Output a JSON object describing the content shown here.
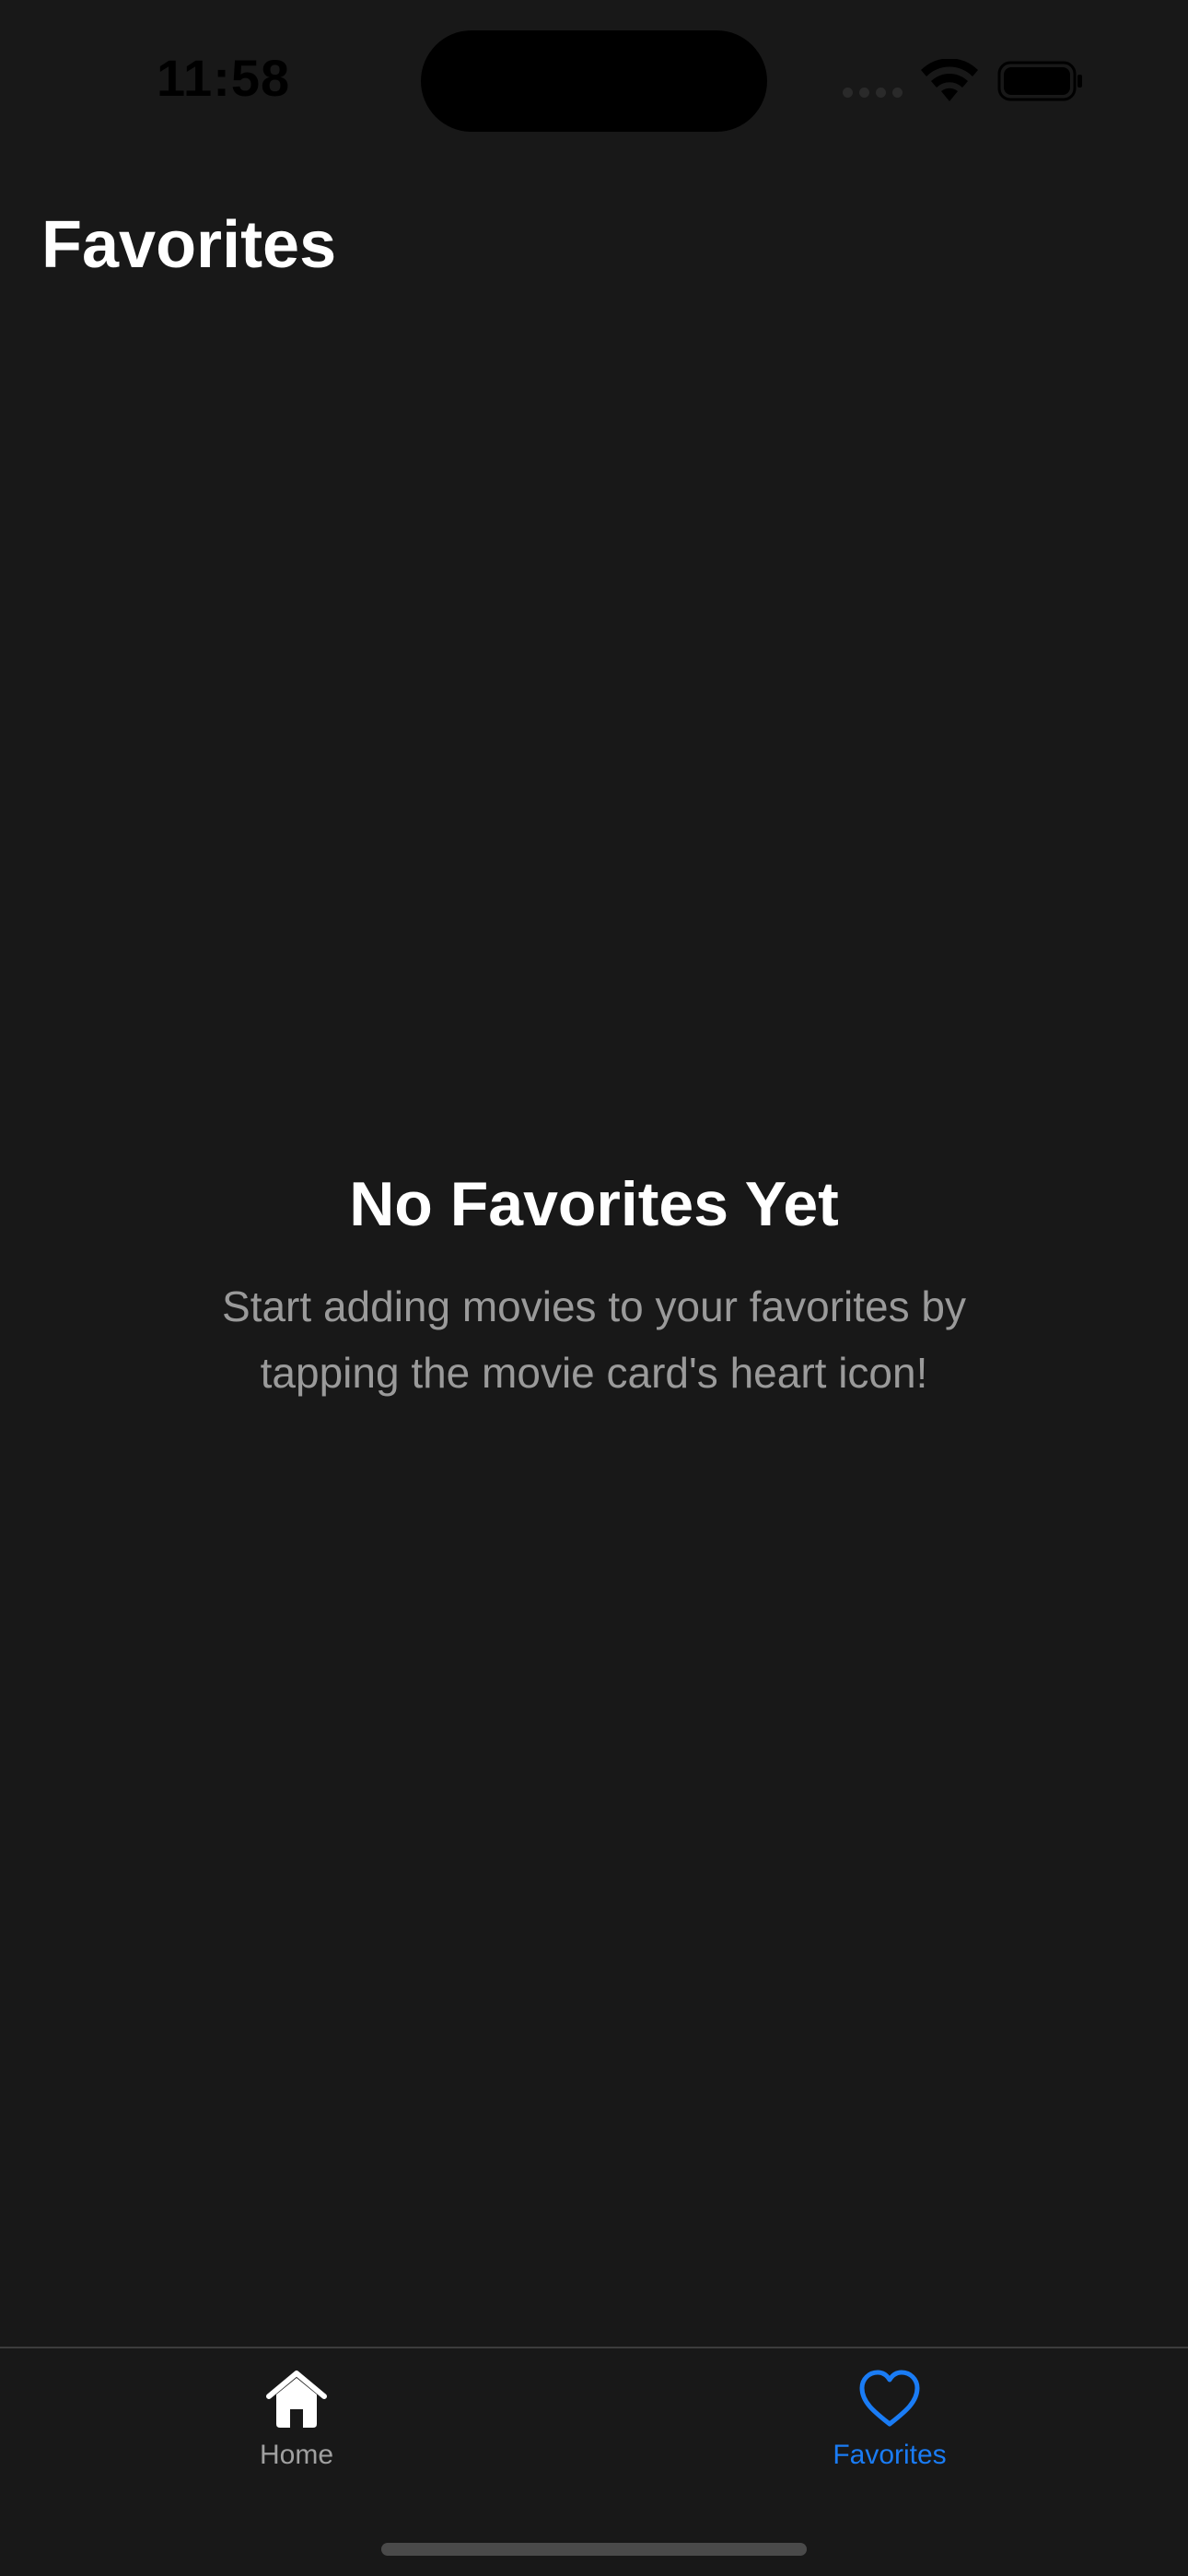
{
  "status_bar": {
    "time": "11:58",
    "icons": [
      "signal-icon",
      "wifi-icon",
      "battery-icon"
    ]
  },
  "nav": {
    "title": "Favorites"
  },
  "empty_state": {
    "title": "No Favorites Yet",
    "message": "Start adding movies to your favorites by tapping the movie card's heart icon!"
  },
  "tab_bar": {
    "items": [
      {
        "label": "Home",
        "icon": "house-icon",
        "selected": false
      },
      {
        "label": "Favorites",
        "icon": "heart-icon",
        "selected": true
      }
    ]
  },
  "colors": {
    "background": "#181818",
    "accent": "#1a7cf5",
    "secondary_text": "#9a9a9a",
    "inactive_tab": "#a0a0a0"
  }
}
